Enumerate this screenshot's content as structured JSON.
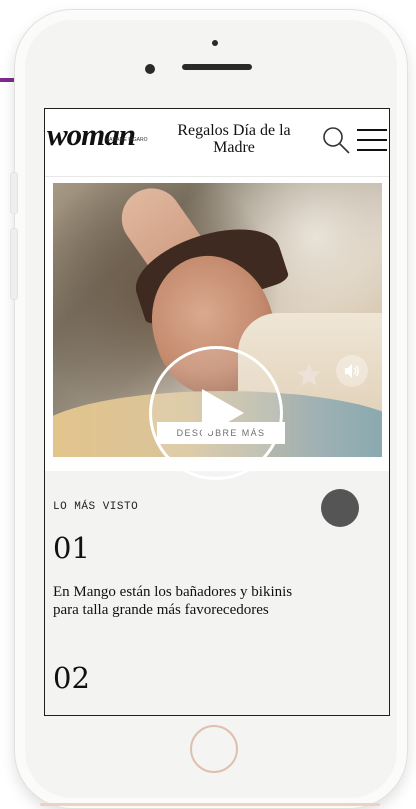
{
  "header": {
    "logo_text": "woman",
    "logo_subtext": "MADAME FIGARO",
    "title": "Regalos Día de la Madre"
  },
  "video": {
    "discover_label": "DESCUBRE MÁS"
  },
  "most_viewed": {
    "section_label": "LO MÁS VISTO",
    "items": [
      {
        "rank": "01",
        "title": "En Mango están los bañadores y bikinis para talla grande más favorecedores"
      },
      {
        "rank": "02",
        "title": ""
      }
    ]
  },
  "colors": {
    "accent": "#7a2e86",
    "dot": "#555555",
    "section_bg": "#f3f3f1"
  },
  "icons": [
    "search-icon",
    "menu-icon",
    "play-icon",
    "sound-icon",
    "star-icon"
  ]
}
